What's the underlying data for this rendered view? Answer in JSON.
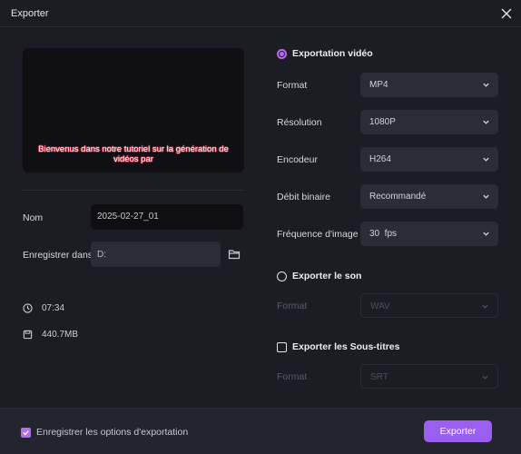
{
  "window": {
    "title": "Exporter"
  },
  "preview": {
    "subtitle": "Bienvenus dans notre tutoriel sur la génération de vidéos par"
  },
  "name": {
    "label": "Nom",
    "value": "2025-02-27_01"
  },
  "save_in": {
    "label": "Enregistrer dans",
    "value": "D:"
  },
  "meta": {
    "duration": "07:34",
    "size": "440.7MB"
  },
  "video_export": {
    "title": "Exportation vidéo",
    "format": {
      "label": "Format",
      "value": "MP4"
    },
    "resolution": {
      "label": "Résolution",
      "value": "1080P"
    },
    "encoder": {
      "label": "Encodeur",
      "value": "H264"
    },
    "bitrate": {
      "label": "Débit binaire",
      "value": "Recommandé"
    },
    "framerate": {
      "label": "Fréquence d'image",
      "value": "30  fps"
    }
  },
  "audio_export": {
    "title": "Exporter le son",
    "format": {
      "label": "Format",
      "value": "WAV"
    }
  },
  "subtitles_export": {
    "title": "Exporter les Sous-titres",
    "format": {
      "label": "Format",
      "value": "SRT"
    }
  },
  "footer": {
    "remember_label": "Enregistrer les options d'exportation",
    "export_button": "Exporter"
  },
  "colors": {
    "accent": "#b56cf0",
    "button": "#9a5ef0",
    "background": "#1c1c24"
  }
}
